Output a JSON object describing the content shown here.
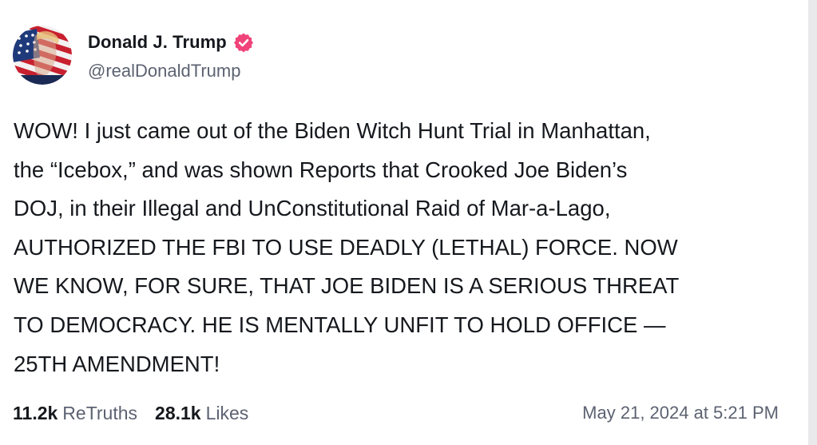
{
  "author": {
    "name": "Donald J. Trump",
    "handle": "@realDonaldTrump",
    "verified": true,
    "verified_color": "#f0437a",
    "avatar_icon": "flag-portrait-avatar"
  },
  "post": {
    "lines": [
      "WOW! I just came out of the Biden Witch Hunt Trial in Manhattan,",
      "the “Icebox,” and was shown Reports that Crooked Joe Biden’s",
      "DOJ, in their Illegal and UnConstitutional Raid of Mar-a-Lago,",
      "AUTHORIZED THE FBI TO USE DEADLY (LETHAL) FORCE. NOW",
      "WE KNOW, FOR SURE, THAT JOE BIDEN IS A SERIOUS THREAT",
      "TO DEMOCRACY. HE IS MENTALLY UNFIT TO HOLD OFFICE —",
      "25TH AMENDMENT!"
    ]
  },
  "stats": {
    "retruths_count": "11.2k",
    "retruths_label": "ReTruths",
    "likes_count": "28.1k",
    "likes_label": "Likes"
  },
  "timestamp": "May 21, 2024 at 5:21 PM"
}
